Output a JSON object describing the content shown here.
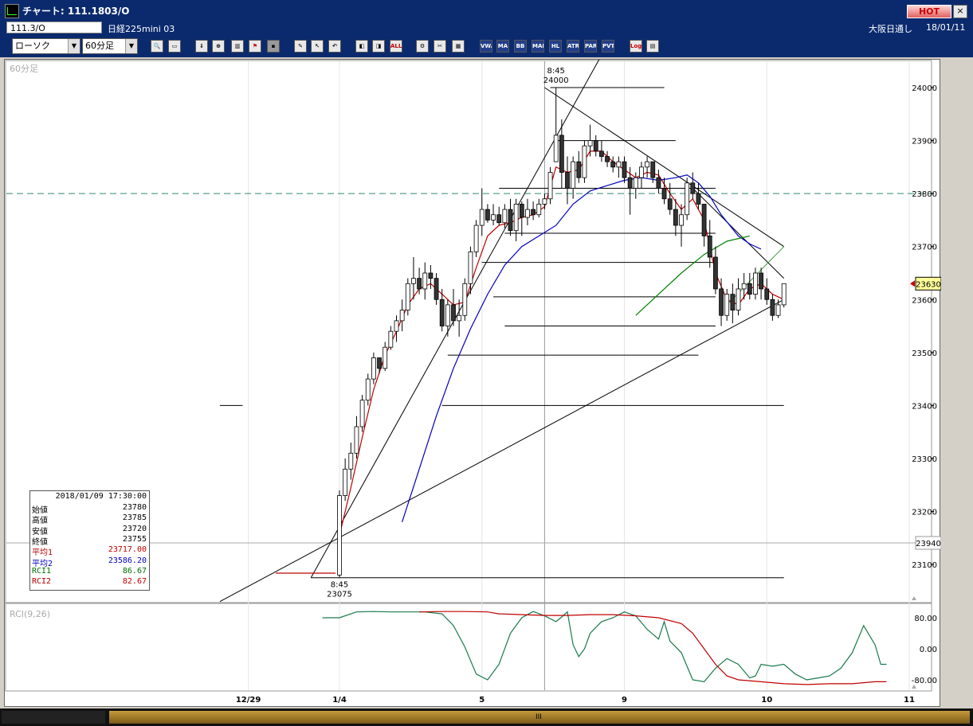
{
  "window": {
    "title": "チャート: 111.1803/O",
    "hot_label": "HOT",
    "close_label": "×"
  },
  "info": {
    "symbol_code": "111.3/O",
    "symbol_name": "日経225mini 03",
    "market": "大阪日通し",
    "date": "18/01/11"
  },
  "toolbar": {
    "chart_type": "ローソク",
    "interval": "60分足",
    "buttons": [
      {
        "name": "search",
        "glyph": "🔍",
        "style": ""
      },
      {
        "name": "window",
        "glyph": "▭",
        "style": ""
      },
      {
        "name": "download",
        "glyph": "⇓",
        "style": ""
      },
      {
        "name": "zoom",
        "glyph": "⊕",
        "style": ""
      },
      {
        "name": "bar-chart",
        "glyph": "▥",
        "style": ""
      },
      {
        "name": "flag",
        "glyph": "⚑",
        "style": "red"
      },
      {
        "name": "disabled",
        "glyph": "▪",
        "style": "dim"
      },
      {
        "name": "pencil",
        "glyph": "✎",
        "style": ""
      },
      {
        "name": "cursor",
        "glyph": "↖",
        "style": ""
      },
      {
        "name": "undo",
        "glyph": "↶",
        "style": ""
      },
      {
        "name": "compare-left",
        "glyph": "◧",
        "style": ""
      },
      {
        "name": "compare-right",
        "glyph": "◨",
        "style": ""
      },
      {
        "name": "all",
        "glyph": "ALL",
        "style": "red"
      },
      {
        "name": "settings",
        "glyph": "⚙",
        "style": ""
      },
      {
        "name": "tools",
        "glyph": "✂",
        "style": ""
      },
      {
        "name": "palette",
        "glyph": "▦",
        "style": ""
      },
      {
        "name": "vwap",
        "glyph": "VWAP",
        "style": "dk"
      },
      {
        "name": "ma",
        "glyph": "MA",
        "style": "dk"
      },
      {
        "name": "bb",
        "glyph": "BB",
        "style": "dk"
      },
      {
        "name": "mae",
        "glyph": "MAE",
        "style": "dk"
      },
      {
        "name": "hl",
        "glyph": "HL",
        "style": "dk"
      },
      {
        "name": "atr",
        "glyph": "ATR",
        "style": "dk"
      },
      {
        "name": "para",
        "glyph": "PARA",
        "style": "dk"
      },
      {
        "name": "pvt",
        "glyph": "PVT",
        "style": "dk"
      },
      {
        "name": "log",
        "glyph": "Log",
        "style": "red"
      },
      {
        "name": "export",
        "glyph": "▤",
        "style": ""
      }
    ]
  },
  "chart_label": "60分足",
  "indicator_label": "RCI(9,26)",
  "legend": {
    "datetime": "2018/01/09  17:30:00",
    "rows": [
      {
        "label": "始値",
        "value": "23780",
        "color": "#000000"
      },
      {
        "label": "高値",
        "value": "23785",
        "color": "#000000"
      },
      {
        "label": "安値",
        "value": "23720",
        "color": "#000000"
      },
      {
        "label": "終値",
        "value": "23755",
        "color": "#000000"
      },
      {
        "label": "平均1",
        "value": "23717.00",
        "color": "#c00000"
      },
      {
        "label": "平均2",
        "value": "23586.20",
        "color": "#0000c0"
      },
      {
        "label": "RCI1",
        "value": "86.67",
        "color": "#007000"
      },
      {
        "label": "RCI2",
        "value": "82.67",
        "color": "#c00000"
      }
    ]
  },
  "chart_data": {
    "type": "candlestick",
    "price_ticks": [
      24000,
      23900,
      23800,
      23700,
      23600,
      23500,
      23400,
      23300,
      23200,
      23100
    ],
    "rci_ticks": [
      "80.00",
      "0.00",
      "-80.00"
    ],
    "x_labels": [
      "12/29",
      "1/4",
      "5",
      "9",
      "10",
      "11"
    ],
    "x_label_bar": [
      -16,
      0,
      25,
      50,
      75,
      100
    ],
    "last_price": "23630",
    "marker_price": "23940",
    "dashed_level": 23800,
    "crosshair_bar": 36,
    "high_annotation": {
      "time": "8:45",
      "price": "24000"
    },
    "low_annotation": {
      "time": "8:45",
      "price": "23075"
    },
    "candles": [
      [
        23080,
        23240,
        23075,
        23230
      ],
      [
        23230,
        23300,
        23220,
        23280
      ],
      [
        23280,
        23330,
        23260,
        23310
      ],
      [
        23310,
        23380,
        23300,
        23360
      ],
      [
        23360,
        23420,
        23350,
        23410
      ],
      [
        23410,
        23460,
        23400,
        23450
      ],
      [
        23450,
        23500,
        23440,
        23490
      ],
      [
        23490,
        23485,
        23460,
        23470
      ],
      [
        23470,
        23520,
        23465,
        23510
      ],
      [
        23510,
        23550,
        23505,
        23540
      ],
      [
        23540,
        23570,
        23520,
        23560
      ],
      [
        23560,
        23600,
        23540,
        23580
      ],
      [
        23580,
        23640,
        23570,
        23630
      ],
      [
        23630,
        23680,
        23600,
        23640
      ],
      [
        23640,
        23660,
        23610,
        23620
      ],
      [
        23620,
        23670,
        23600,
        23650
      ],
      [
        23650,
        23665,
        23620,
        23640
      ],
      [
        23640,
        23650,
        23590,
        23600
      ],
      [
        23600,
        23620,
        23540,
        23550
      ],
      [
        23550,
        23600,
        23530,
        23590
      ],
      [
        23590,
        23620,
        23550,
        23560
      ],
      [
        23560,
        23600,
        23530,
        23570
      ],
      [
        23570,
        23640,
        23560,
        23630
      ],
      [
        23630,
        23700,
        23610,
        23690
      ],
      [
        23690,
        23750,
        23680,
        23740
      ],
      [
        23740,
        23810,
        23720,
        23770
      ],
      [
        23770,
        23780,
        23745,
        23750
      ],
      [
        23750,
        23780,
        23740,
        23760
      ],
      [
        23760,
        23775,
        23740,
        23745
      ],
      [
        23745,
        23780,
        23735,
        23770
      ],
      [
        23770,
        23790,
        23720,
        23730
      ],
      [
        23730,
        23790,
        23710,
        23780
      ],
      [
        23780,
        23785,
        23720,
        23755
      ],
      [
        23755,
        23790,
        23740,
        23770
      ],
      [
        23770,
        23785,
        23750,
        23760
      ],
      [
        23760,
        23790,
        23755,
        23780
      ],
      [
        23780,
        23800,
        23770,
        23790
      ],
      [
        23790,
        23850,
        23780,
        23840
      ],
      [
        23860,
        24000,
        23880,
        23910
      ],
      [
        23910,
        23940,
        23810,
        23840
      ],
      [
        23840,
        23870,
        23780,
        23810
      ],
      [
        23810,
        23870,
        23790,
        23860
      ],
      [
        23860,
        23880,
        23820,
        23830
      ],
      [
        23830,
        23900,
        23820,
        23890
      ],
      [
        23890,
        23930,
        23870,
        23900
      ],
      [
        23900,
        23910,
        23870,
        23880
      ],
      [
        23880,
        23900,
        23860,
        23870
      ],
      [
        23870,
        23880,
        23850,
        23860
      ],
      [
        23860,
        23870,
        23840,
        23850
      ],
      [
        23850,
        23870,
        23830,
        23860
      ],
      [
        23860,
        23870,
        23820,
        23830
      ],
      [
        23830,
        23850,
        23760,
        23810
      ],
      [
        23810,
        23840,
        23790,
        23830
      ],
      [
        23830,
        23860,
        23810,
        23850
      ],
      [
        23850,
        23870,
        23830,
        23860
      ],
      [
        23860,
        23850,
        23820,
        23830
      ],
      [
        23830,
        23845,
        23800,
        23810
      ],
      [
        23810,
        23830,
        23780,
        23790
      ],
      [
        23790,
        23820,
        23760,
        23770
      ],
      [
        23770,
        23790,
        23720,
        23740
      ],
      [
        23740,
        23780,
        23700,
        23760
      ],
      [
        23760,
        23830,
        23750,
        23820
      ],
      [
        23820,
        23840,
        23790,
        23800
      ],
      [
        23800,
        23820,
        23770,
        23780
      ],
      [
        23780,
        23760,
        23700,
        23720
      ],
      [
        23720,
        23750,
        23660,
        23680
      ],
      [
        23680,
        23700,
        23610,
        23620
      ],
      [
        23620,
        23640,
        23550,
        23570
      ],
      [
        23570,
        23620,
        23560,
        23610
      ],
      [
        23610,
        23630,
        23555,
        23580
      ],
      [
        23580,
        23640,
        23570,
        23620
      ],
      [
        23620,
        23650,
        23600,
        23630
      ],
      [
        23630,
        23650,
        23600,
        23610
      ],
      [
        23610,
        23660,
        23600,
        23650
      ],
      [
        23650,
        23660,
        23600,
        23620
      ],
      [
        23620,
        23640,
        23590,
        23600
      ],
      [
        23600,
        23610,
        23560,
        23570
      ],
      [
        23570,
        23600,
        23565,
        23590
      ],
      [
        23590,
        23630,
        23585,
        23630
      ]
    ],
    "ma1": [
      [
        0,
        23155
      ],
      [
        2,
        23245
      ],
      [
        4,
        23340
      ],
      [
        6,
        23430
      ],
      [
        8,
        23495
      ],
      [
        10,
        23540
      ],
      [
        12,
        23590
      ],
      [
        14,
        23620
      ],
      [
        16,
        23630
      ],
      [
        18,
        23610
      ],
      [
        20,
        23590
      ],
      [
        22,
        23595
      ],
      [
        24,
        23660
      ],
      [
        26,
        23720
      ],
      [
        28,
        23740
      ],
      [
        30,
        23745
      ],
      [
        32,
        23755
      ],
      [
        34,
        23760
      ],
      [
        36,
        23775
      ],
      [
        38,
        23850
      ],
      [
        40,
        23840
      ],
      [
        42,
        23845
      ],
      [
        44,
        23880
      ],
      [
        46,
        23880
      ],
      [
        48,
        23860
      ],
      [
        50,
        23845
      ],
      [
        52,
        23830
      ],
      [
        54,
        23840
      ],
      [
        56,
        23835
      ],
      [
        58,
        23800
      ],
      [
        60,
        23770
      ],
      [
        62,
        23790
      ],
      [
        64,
        23750
      ],
      [
        66,
        23650
      ],
      [
        68,
        23600
      ],
      [
        70,
        23590
      ],
      [
        72,
        23620
      ],
      [
        74,
        23630
      ],
      [
        76,
        23610
      ],
      [
        78,
        23600
      ]
    ],
    "ma2": [
      [
        11,
        23180
      ],
      [
        14,
        23280
      ],
      [
        17,
        23380
      ],
      [
        20,
        23470
      ],
      [
        23,
        23545
      ],
      [
        26,
        23610
      ],
      [
        29,
        23665
      ],
      [
        32,
        23700
      ],
      [
        35,
        23720
      ],
      [
        38,
        23740
      ],
      [
        41,
        23780
      ],
      [
        44,
        23805
      ],
      [
        47,
        23815
      ],
      [
        50,
        23825
      ],
      [
        53,
        23830
      ],
      [
        56,
        23825
      ],
      [
        59,
        23830
      ],
      [
        61,
        23835
      ],
      [
        63,
        23820
      ],
      [
        65,
        23795
      ],
      [
        67,
        23760
      ],
      [
        70,
        23720
      ],
      [
        72,
        23705
      ],
      [
        74,
        23695
      ]
    ],
    "ma3": [
      [
        52,
        23570
      ],
      [
        56,
        23610
      ],
      [
        60,
        23650
      ],
      [
        64,
        23685
      ],
      [
        68,
        23710
      ],
      [
        72,
        23720
      ]
    ],
    "rci1": [
      [
        -3,
        80
      ],
      [
        0,
        80
      ],
      [
        3,
        95
      ],
      [
        6,
        96
      ],
      [
        9,
        95
      ],
      [
        12,
        95
      ],
      [
        15,
        95
      ],
      [
        18,
        90
      ],
      [
        20,
        60
      ],
      [
        22,
        5
      ],
      [
        24,
        -65
      ],
      [
        26,
        -80
      ],
      [
        28,
        -40
      ],
      [
        30,
        40
      ],
      [
        32,
        80
      ],
      [
        34,
        96
      ],
      [
        36,
        85
      ],
      [
        38,
        70
      ],
      [
        39,
        82
      ],
      [
        40,
        95
      ],
      [
        41,
        10
      ],
      [
        42,
        -20
      ],
      [
        43,
        0
      ],
      [
        44,
        40
      ],
      [
        46,
        70
      ],
      [
        48,
        80
      ],
      [
        50,
        95
      ],
      [
        52,
        85
      ],
      [
        54,
        50
      ],
      [
        56,
        25
      ],
      [
        57,
        70
      ],
      [
        58,
        20
      ],
      [
        60,
        -10
      ],
      [
        62,
        -80
      ],
      [
        64,
        -85
      ],
      [
        66,
        -50
      ],
      [
        68,
        -25
      ],
      [
        70,
        -40
      ],
      [
        72,
        -75
      ],
      [
        73,
        -70
      ],
      [
        74,
        -40
      ],
      [
        76,
        -45
      ],
      [
        78,
        -40
      ],
      [
        80,
        -65
      ],
      [
        82,
        -80
      ],
      [
        84,
        -75
      ],
      [
        86,
        -70
      ],
      [
        88,
        -50
      ],
      [
        90,
        -10
      ],
      [
        92,
        60
      ],
      [
        94,
        10
      ],
      [
        95,
        -40
      ],
      [
        96,
        -40
      ]
    ],
    "rci2": [
      [
        14,
        95
      ],
      [
        18,
        96
      ],
      [
        22,
        96
      ],
      [
        26,
        95
      ],
      [
        28,
        90
      ],
      [
        32,
        88
      ],
      [
        36,
        86
      ],
      [
        40,
        86
      ],
      [
        44,
        88
      ],
      [
        48,
        88
      ],
      [
        52,
        85
      ],
      [
        56,
        80
      ],
      [
        60,
        65
      ],
      [
        62,
        40
      ],
      [
        64,
        0
      ],
      [
        66,
        -40
      ],
      [
        68,
        -70
      ],
      [
        70,
        -80
      ],
      [
        74,
        -85
      ],
      [
        78,
        -90
      ],
      [
        82,
        -92
      ],
      [
        86,
        -90
      ],
      [
        90,
        -90
      ],
      [
        94,
        -85
      ],
      [
        96,
        -85
      ]
    ],
    "hlines": [
      [
        24000,
        37,
        57
      ],
      [
        23900,
        38,
        59
      ],
      [
        23810,
        28,
        66
      ],
      [
        23725,
        29,
        66
      ],
      [
        23670,
        25,
        66
      ],
      [
        23605,
        27,
        66
      ],
      [
        23550,
        29,
        66
      ],
      [
        23495,
        19,
        63
      ],
      [
        23400,
        -21,
        -17
      ],
      [
        23400,
        18,
        78
      ],
      [
        23075,
        -5,
        78
      ]
    ],
    "trendlines": [
      [
        -21,
        23030,
        78,
        23600
      ],
      [
        -5,
        23075,
        48,
        24100
      ],
      [
        36,
        24000,
        78,
        23700
      ],
      [
        62,
        23810,
        78,
        23640
      ],
      [
        68,
        23590,
        78,
        23700
      ]
    ]
  }
}
